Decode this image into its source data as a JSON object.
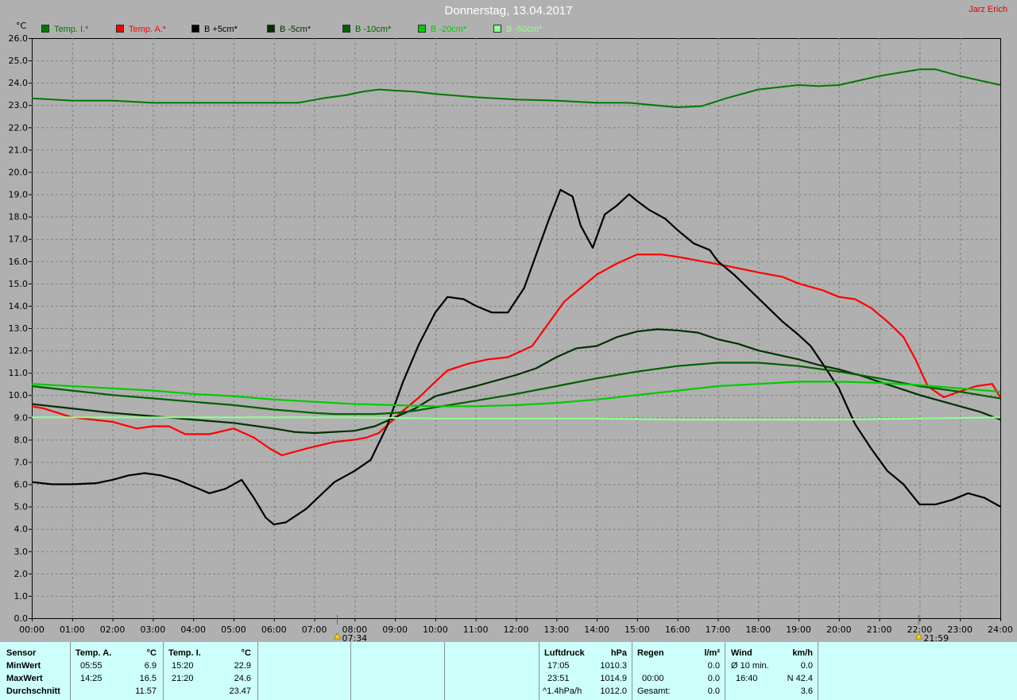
{
  "header": {
    "title": "Donnerstag, 13.04.2017",
    "author": "Jarz Erich"
  },
  "colors": {
    "background": "#b0b0b0",
    "plot_background": "#b0b0b0",
    "grid": "#808080",
    "stats_background": "#ccfffa"
  },
  "chart_data": {
    "type": "line",
    "y_unit": "°C",
    "ylim": [
      0,
      26
    ],
    "yticks": [
      "0.0",
      "1.0",
      "2.0",
      "3.0",
      "4.0",
      "5.0",
      "6.0",
      "7.0",
      "8.0",
      "9.0",
      "10.0",
      "11.0",
      "12.0",
      "13.0",
      "14.0",
      "15.0",
      "16.0",
      "17.0",
      "18.0",
      "19.0",
      "20.0",
      "21.0",
      "22.0",
      "23.0",
      "24.0",
      "25.0",
      "26.0"
    ],
    "xlim": [
      0,
      24
    ],
    "xticks": [
      "00:00",
      "01:00",
      "02:00",
      "03:00",
      "04:00",
      "05:00",
      "06:00",
      "07:00",
      "08:00",
      "09:00",
      "10:00",
      "11:00",
      "12:00",
      "13:00",
      "14:00",
      "15:00",
      "16:00",
      "17:00",
      "18:00",
      "19:00",
      "20:00",
      "21:00",
      "22:00",
      "23:00",
      "24:00"
    ],
    "grid": true,
    "legend_position": "top-left",
    "markers": [
      {
        "label": "07:34",
        "x": 7.57,
        "icon": "sunrise-icon"
      },
      {
        "label": "21:59",
        "x": 21.98,
        "icon": "sunset-icon"
      }
    ],
    "series": [
      {
        "name": "Temp. I.*",
        "color": "#007800",
        "x": [
          0,
          1,
          2,
          3,
          4,
          5,
          6,
          6.6,
          7.2,
          7.8,
          8.2,
          8.6,
          9,
          9.5,
          10,
          11,
          12,
          13,
          14,
          14.8,
          15.4,
          16,
          16.6,
          17.2,
          18,
          19,
          19.5,
          20,
          21,
          22,
          22.4,
          23,
          24
        ],
        "y": [
          23.3,
          23.2,
          23.2,
          23.1,
          23.1,
          23.1,
          23.1,
          23.1,
          23.3,
          23.45,
          23.6,
          23.7,
          23.65,
          23.6,
          23.5,
          23.35,
          23.25,
          23.2,
          23.1,
          23.1,
          23.0,
          22.9,
          22.95,
          23.3,
          23.7,
          23.9,
          23.85,
          23.9,
          24.3,
          24.6,
          24.6,
          24.3,
          23.9
        ]
      },
      {
        "name": "Temp. A.*",
        "color": "#ff0000",
        "x": [
          0,
          0.3,
          1,
          2,
          2.6,
          3,
          3.4,
          3.8,
          4.4,
          5,
          5.5,
          5.9,
          6.2,
          6.8,
          7.5,
          8,
          8.3,
          8.6,
          9.2,
          9.6,
          10,
          10.3,
          10.8,
          11.3,
          11.8,
          12.4,
          12.8,
          13.2,
          13.6,
          14,
          14.4,
          14.5,
          15,
          15.6,
          16,
          16.6,
          17.2,
          18,
          18.6,
          19,
          19.6,
          20,
          20.4,
          20.8,
          21.2,
          21.6,
          21.9,
          22.2,
          22.6,
          22.9,
          23.4,
          23.8,
          24
        ],
        "y": [
          9.5,
          9.4,
          9.0,
          8.8,
          8.5,
          8.6,
          8.6,
          8.25,
          8.25,
          8.5,
          8.1,
          7.6,
          7.3,
          7.6,
          7.9,
          8.0,
          8.1,
          8.3,
          9.3,
          9.9,
          10.6,
          11.1,
          11.4,
          11.6,
          11.7,
          12.2,
          13.2,
          14.2,
          14.8,
          15.4,
          15.8,
          15.9,
          16.3,
          16.3,
          16.2,
          16.0,
          15.8,
          15.5,
          15.3,
          15.0,
          14.7,
          14.4,
          14.3,
          13.9,
          13.3,
          12.6,
          11.6,
          10.4,
          9.9,
          10.1,
          10.4,
          10.5,
          9.9
        ]
      },
      {
        "name": "B +5cm*",
        "color": "#000000",
        "x": [
          0,
          0.5,
          1,
          1.6,
          2,
          2.4,
          2.8,
          3.2,
          3.6,
          4,
          4.4,
          4.8,
          5.2,
          5.5,
          5.8,
          6,
          6.3,
          6.8,
          7.5,
          8,
          8.4,
          8.8,
          9.2,
          9.6,
          10,
          10.3,
          10.7,
          11,
          11.4,
          11.8,
          12.2,
          12.5,
          12.8,
          13.1,
          13.4,
          13.6,
          13.9,
          14.2,
          14.5,
          14.8,
          15,
          15.3,
          15.7,
          16,
          16.4,
          16.8,
          17,
          17.4,
          17.8,
          18.2,
          18.6,
          19,
          19.3,
          19.6,
          20,
          20.4,
          20.8,
          21.2,
          21.6,
          22,
          22.4,
          22.8,
          23.2,
          23.6,
          24
        ],
        "y": [
          6.1,
          6.0,
          6.0,
          6.05,
          6.2,
          6.4,
          6.5,
          6.4,
          6.2,
          5.9,
          5.6,
          5.8,
          6.2,
          5.4,
          4.5,
          4.2,
          4.3,
          4.9,
          6.1,
          6.6,
          7.1,
          8.6,
          10.6,
          12.3,
          13.7,
          14.4,
          14.3,
          14.0,
          13.7,
          13.7,
          14.8,
          16.3,
          17.8,
          19.2,
          18.9,
          17.6,
          16.6,
          18.1,
          18.5,
          19.0,
          18.7,
          18.3,
          17.9,
          17.4,
          16.8,
          16.5,
          16.0,
          15.4,
          14.7,
          14.0,
          13.3,
          12.7,
          12.2,
          11.4,
          10.3,
          8.7,
          7.6,
          6.6,
          6.0,
          5.1,
          5.1,
          5.3,
          5.6,
          5.4,
          5.0
        ]
      },
      {
        "name": "B -5cm*",
        "color": "#003000",
        "x": [
          0,
          1,
          2,
          3,
          4,
          5,
          6,
          6.5,
          7,
          8,
          8.5,
          9,
          9.5,
          10,
          11,
          12,
          12.5,
          13,
          13.5,
          14,
          14.5,
          15,
          15.5,
          16,
          16.5,
          17,
          17.5,
          18,
          18.5,
          19,
          19.5,
          20,
          20.5,
          21,
          21.5,
          22,
          22.5,
          23,
          23.5,
          24
        ],
        "y": [
          9.6,
          9.4,
          9.2,
          9.05,
          8.9,
          8.75,
          8.5,
          8.35,
          8.3,
          8.4,
          8.6,
          9.0,
          9.4,
          9.95,
          10.4,
          10.9,
          11.2,
          11.7,
          12.1,
          12.2,
          12.6,
          12.85,
          12.95,
          12.9,
          12.8,
          12.5,
          12.3,
          12.0,
          11.8,
          11.6,
          11.35,
          11.15,
          10.9,
          10.6,
          10.3,
          10.0,
          9.75,
          9.5,
          9.25,
          8.9
        ]
      },
      {
        "name": "B -10cm*",
        "color": "#006000",
        "x": [
          0,
          1,
          2,
          3,
          4,
          5,
          6,
          7,
          7.5,
          8,
          8.5,
          9,
          9.5,
          10,
          11,
          12,
          13,
          14,
          15,
          16,
          17,
          18,
          19,
          20,
          21,
          22,
          23,
          24
        ],
        "y": [
          10.4,
          10.2,
          10.0,
          9.85,
          9.7,
          9.55,
          9.35,
          9.2,
          9.15,
          9.15,
          9.15,
          9.2,
          9.3,
          9.45,
          9.75,
          10.05,
          10.4,
          10.75,
          11.05,
          11.3,
          11.45,
          11.45,
          11.3,
          11.05,
          10.75,
          10.4,
          10.15,
          9.85
        ]
      },
      {
        "name": "B -20cm*",
        "color": "#00cc00",
        "x": [
          0,
          1,
          2,
          3,
          4,
          5,
          6,
          7,
          8,
          9,
          10,
          11,
          12,
          13,
          14,
          15,
          16,
          17,
          18,
          19,
          20,
          21,
          22,
          23,
          24
        ],
        "y": [
          10.5,
          10.4,
          10.3,
          10.2,
          10.05,
          9.95,
          9.8,
          9.7,
          9.6,
          9.55,
          9.5,
          9.5,
          9.55,
          9.65,
          9.8,
          10.0,
          10.2,
          10.4,
          10.5,
          10.6,
          10.6,
          10.55,
          10.45,
          10.3,
          10.15
        ]
      },
      {
        "name": "B -50cm*",
        "color": "#90ff90",
        "x": [
          0,
          2,
          4,
          6,
          8,
          10,
          12,
          14,
          16,
          18,
          20,
          22,
          24
        ],
        "y": [
          9.0,
          9.0,
          9.0,
          9.0,
          9.0,
          8.95,
          8.95,
          8.95,
          8.9,
          8.9,
          8.9,
          8.95,
          9.0
        ]
      }
    ]
  },
  "stats": {
    "sensor": {
      "header": "Sensor",
      "rows": [
        "MinWert",
        "MaxWert",
        "Durchschnitt"
      ]
    },
    "temp_a": {
      "header": "Temp. A.",
      "unit": "°C",
      "min_time": "05:55",
      "min": "6.9",
      "max_time": "14:25",
      "max": "16.5",
      "avg": "11.57"
    },
    "temp_i": {
      "header": "Temp. I.",
      "unit": "°C",
      "min_time": "15:20",
      "min": "22.9",
      "max_time": "21:20",
      "max": "24.6",
      "avg": "23.47"
    },
    "pressure": {
      "header": "Luftdruck",
      "unit": "hPa",
      "min_time": "17:05",
      "min": "1010.3",
      "max_time": "23:51",
      "max": "1014.9",
      "trend": "^1.4hPa/h",
      "avg": "1012.0"
    },
    "rain": {
      "header": "Regen",
      "unit": "l/m²",
      "r1_label": "",
      "r1_value": "0.0",
      "r2_label": "00:00",
      "r2_value": "0.0",
      "r3_label": "Gesamt:",
      "r3_value": "0.0"
    },
    "wind": {
      "header": "Wind",
      "unit": "km/h",
      "r1_label": "Ø 10 min.",
      "r1_value": "0.0",
      "r2_label": "16:40",
      "r2_value": "N 42.4",
      "r3_value": "3.6"
    }
  }
}
